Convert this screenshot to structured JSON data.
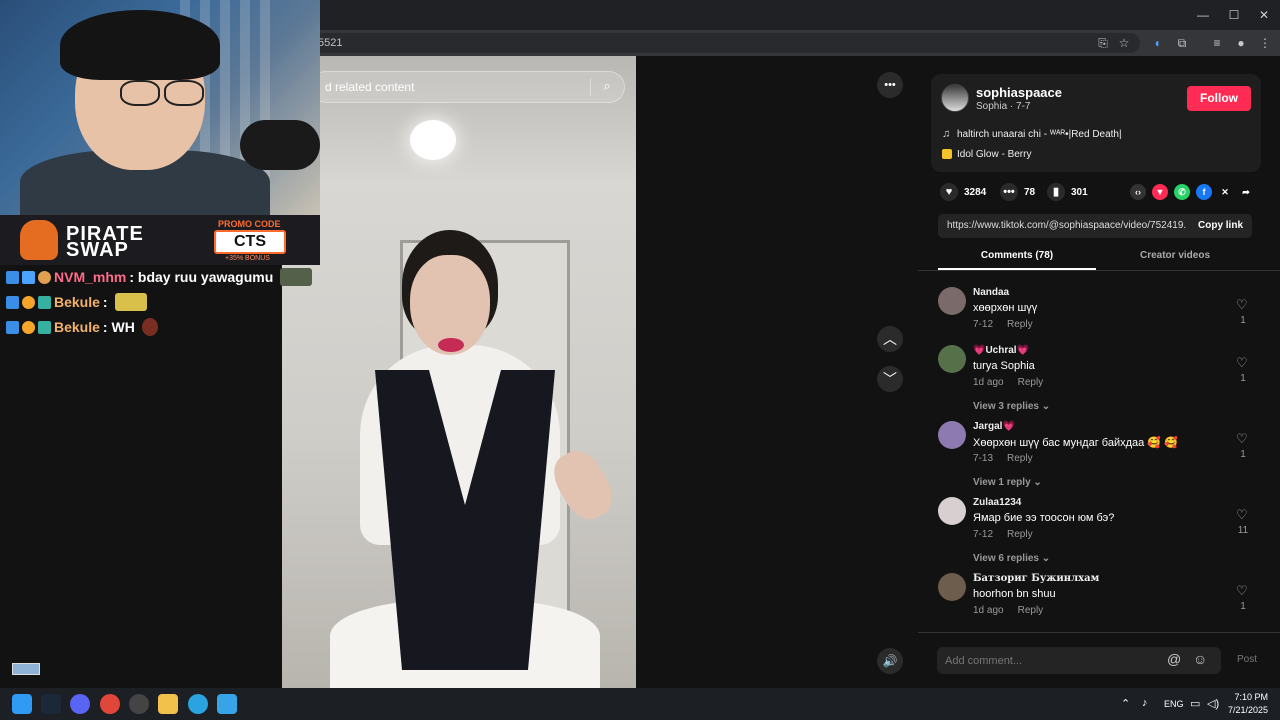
{
  "browser": {
    "url": "5521",
    "window_controls": [
      "—",
      "☐",
      "✕"
    ]
  },
  "stream": {
    "promo_code_label": "PROMO CODE",
    "promo_code": "CTS",
    "promo_bonus": "+35% BONUS",
    "brand_line1": "PIRATE",
    "brand_line2": "SWAP",
    "chat": [
      {
        "user": "NVM_mhm",
        "message": ": bday ruu yawagumu",
        "user_color": "#ff6b8a"
      },
      {
        "user": "Bekule",
        "message": " :",
        "user_color": "#f2b26b"
      },
      {
        "user": "Bekule",
        "message": " : WH",
        "user_color": "#f2b26b"
      }
    ]
  },
  "video": {
    "search_placeholder": "d related content",
    "more_icon": "•••",
    "prev_icon": "︿",
    "next_icon": "﹀",
    "volume_icon": "🔊"
  },
  "author": {
    "username": "sophiaspaace",
    "meta": "Sophia · 7-7",
    "follow_label": "Follow",
    "music": "haltirch unaarai chi - ᵂᴬᴿ•|Red Death|",
    "effect": "Idol Glow - Berry"
  },
  "stats": {
    "likes": "3284",
    "comments": "78",
    "saves": "301"
  },
  "share": {
    "url": "https://www.tiktok.com/@sophiaspaace/video/752419...",
    "copy_label": "Copy link"
  },
  "tabs": {
    "comments": "Comments (78)",
    "creator": "Creator videos"
  },
  "comments": [
    {
      "user": "Nandaa",
      "text": "хөөрхөн шүү",
      "date": "7-12",
      "reply": "Reply",
      "likes": "1",
      "views": "",
      "avatar_color": "#7a6a6a"
    },
    {
      "user": "💗Uchral💗",
      "text": "turya Sophia",
      "date": "1d ago",
      "reply": "Reply",
      "likes": "1",
      "views": "View 3 replies ⌄",
      "avatar_color": "#56704a"
    },
    {
      "user": "Jargal💗",
      "text": "Хөөрхөн шүү бас мундаг байхдаа 🥰 🥰",
      "date": "7-13",
      "reply": "Reply",
      "likes": "1",
      "views": "View 1 reply ⌄",
      "avatar_color": "#8c7ab0"
    },
    {
      "user": "Zulaa1234",
      "text": "Ямар бие ээ тоосон юм бэ?",
      "date": "7-12",
      "reply": "Reply",
      "likes": "11",
      "views": "View 6 replies ⌄",
      "avatar_color": "#d8d0d0"
    },
    {
      "user": "Батзориг Бужинлхам",
      "text": "hoorhon bn shuu",
      "date": "1d ago",
      "reply": "Reply",
      "likes": "1",
      "views": "",
      "avatar_color": "#6c5d4c"
    }
  ],
  "composer": {
    "placeholder": "Add comment...",
    "post_label": "Post"
  },
  "taskbar": {
    "lang": "ENG",
    "time": "7:10 PM",
    "date": "7/21/2025"
  },
  "colors": {
    "accent": "#fe2c55",
    "bg": "#121212",
    "panel": "#1e1e1e"
  }
}
